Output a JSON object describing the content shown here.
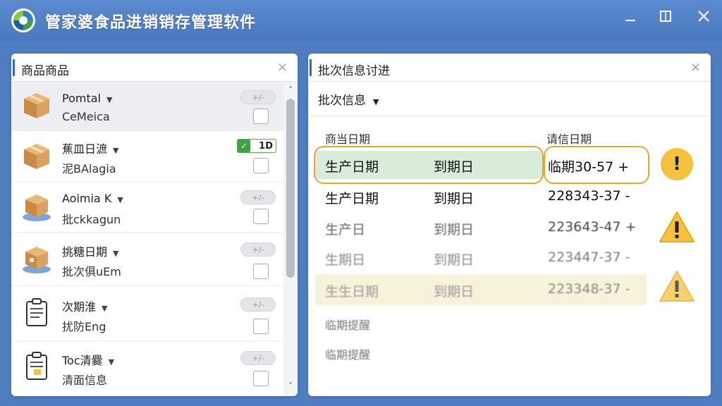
{
  "app": {
    "title": "管家婆食品进销销存管理软件"
  },
  "colors": {
    "titlebar": "#4a79bd",
    "accent": "#2f6cc4",
    "highlight_green": "#d8ecd9",
    "highlight_yellow": "#f7f2dc",
    "warning": "#f5c23e"
  },
  "left_panel": {
    "title": "商品商品",
    "close": "×",
    "items": [
      {
        "icon": "box-icon",
        "name": "Pomtal",
        "sub": "CeMeica",
        "toggle": "+/-",
        "selected": true
      },
      {
        "icon": "box-icon",
        "name": "蕉皿日㵂",
        "sub": "泥BAlagia",
        "toggle_on": true,
        "toggle_value": "1D"
      },
      {
        "icon": "box-icon",
        "name": "Aoimia K",
        "sub": "批ckkagun",
        "toggle": "+/-"
      },
      {
        "icon": "box-icon",
        "name": "挑糖日期",
        "sub": "批次俱uEm",
        "toggle": "+/-"
      },
      {
        "icon": "clipboard-icon",
        "name": "次期淮",
        "sub": "扰防Eng",
        "toggle": "+/-"
      },
      {
        "icon": "clipboard-icon",
        "name": "Toc清爨",
        "sub": "清面信息",
        "toggle": "+/-"
      }
    ]
  },
  "right_panel": {
    "title": "批次信息讨进",
    "close": "×",
    "dropdown": "批次信息",
    "columns": [
      "商当日期",
      "请信日期"
    ],
    "rows": [
      {
        "a": "生产日期",
        "b": "到期日",
        "c": "临期30-57 +",
        "status": "urgent"
      },
      {
        "a": "生产日期",
        "b": "到期日",
        "c": "228343-37 -",
        "status": "none"
      },
      {
        "a": "生产日",
        "b": "到期日",
        "c": "223643-47 +",
        "status": "warning"
      },
      {
        "a": "生期日",
        "b": "到期日",
        "c": "223447-37 -",
        "status": "none"
      },
      {
        "a": "生生日期",
        "b": "到期日",
        "c": "223348-37 -",
        "status": "warning"
      }
    ],
    "reminders": [
      "临期提醒",
      "临期提醒"
    ]
  }
}
